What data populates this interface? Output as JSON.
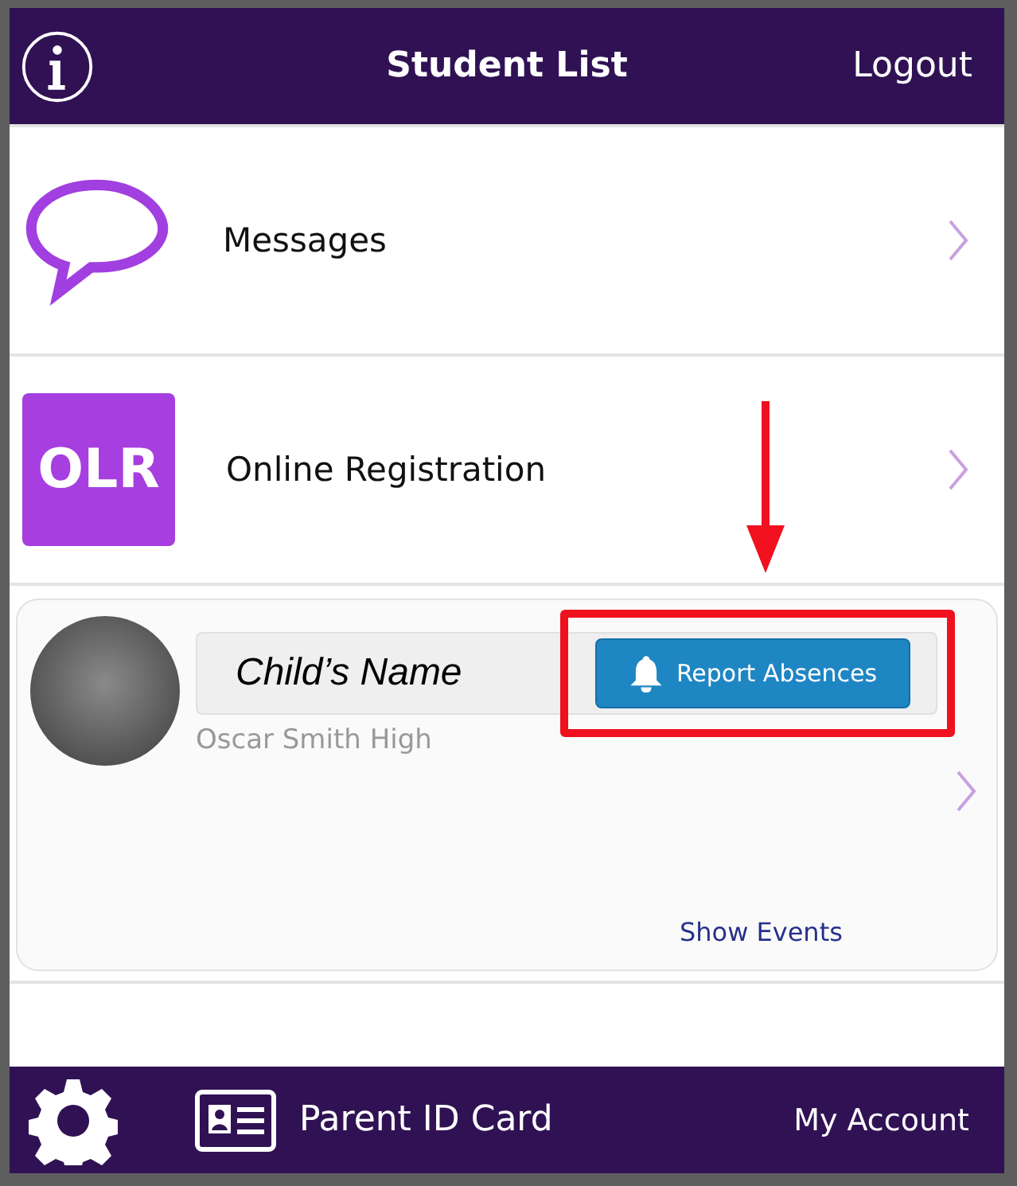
{
  "header": {
    "title": "Student List",
    "action": "Logout"
  },
  "menu": [
    {
      "kind": "chat",
      "label": "Messages"
    },
    {
      "kind": "badge",
      "badge": "OLR",
      "label": "Online Registration"
    }
  ],
  "student": {
    "name": "Child’s Name",
    "school": "Oscar Smith High",
    "button": "Report Absences",
    "link": "Show Events"
  },
  "footer": {
    "card": "Parent ID Card",
    "account": "My Account"
  }
}
